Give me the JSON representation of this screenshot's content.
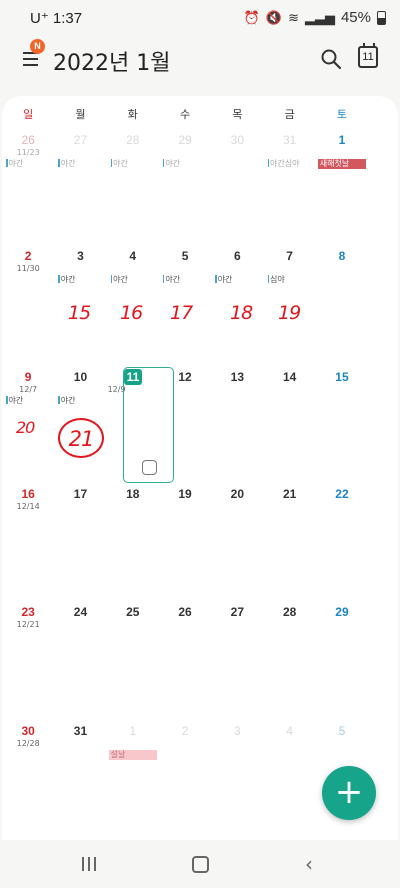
{
  "status_bar": {
    "carrier": "U⁺",
    "time": "1:37",
    "battery": "45%"
  },
  "header": {
    "badge": "N",
    "title": "2022년 1월",
    "today_label": "11"
  },
  "weekdays": [
    "일",
    "월",
    "화",
    "수",
    "목",
    "금",
    "토"
  ],
  "weeks": [
    [
      {
        "day": "26",
        "lunar": "11/23",
        "events": [
          "야간"
        ],
        "dim": true
      },
      {
        "day": "27",
        "events": [
          "야간"
        ],
        "dim": true
      },
      {
        "day": "28",
        "events": [
          "야간"
        ],
        "dim": true
      },
      {
        "day": "29",
        "events": [
          "야간"
        ],
        "dim": true
      },
      {
        "day": "30",
        "events": [],
        "dim": true
      },
      {
        "day": "31",
        "events": [
          "야간심야"
        ],
        "dim": true
      },
      {
        "day": "1",
        "events": [],
        "holiday": "새해첫날"
      }
    ],
    [
      {
        "day": "2",
        "lunar": "11/30",
        "events": []
      },
      {
        "day": "3",
        "events": [
          "야간"
        ]
      },
      {
        "day": "4",
        "events": [
          "야간"
        ]
      },
      {
        "day": "5",
        "events": [
          "야간"
        ]
      },
      {
        "day": "6",
        "events": [
          "야간"
        ]
      },
      {
        "day": "7",
        "events": [
          "심야"
        ]
      },
      {
        "day": "8",
        "events": []
      }
    ],
    [
      {
        "day": "9",
        "lunar": "12/7",
        "events": [
          "야간"
        ]
      },
      {
        "day": "10",
        "events": [
          "야간"
        ]
      },
      {
        "day": "11",
        "lunar": "12/9",
        "events": [],
        "today": true
      },
      {
        "day": "12",
        "events": []
      },
      {
        "day": "13",
        "events": []
      },
      {
        "day": "14",
        "events": []
      },
      {
        "day": "15",
        "events": []
      }
    ],
    [
      {
        "day": "16",
        "lunar": "12/14",
        "events": []
      },
      {
        "day": "17",
        "events": []
      },
      {
        "day": "18",
        "events": []
      },
      {
        "day": "19",
        "events": []
      },
      {
        "day": "20",
        "events": []
      },
      {
        "day": "21",
        "events": []
      },
      {
        "day": "22",
        "events": []
      }
    ],
    [
      {
        "day": "23",
        "lunar": "12/21",
        "events": []
      },
      {
        "day": "24",
        "events": []
      },
      {
        "day": "25",
        "events": []
      },
      {
        "day": "26",
        "events": []
      },
      {
        "day": "27",
        "events": []
      },
      {
        "day": "28",
        "events": []
      },
      {
        "day": "29",
        "events": []
      }
    ],
    [
      {
        "day": "30",
        "lunar": "12/28",
        "events": []
      },
      {
        "day": "31",
        "events": []
      },
      {
        "day": "1",
        "events": [],
        "dim": true,
        "holiday_pink": "설날"
      },
      {
        "day": "2",
        "events": [],
        "dim": true
      },
      {
        "day": "3",
        "events": [],
        "dim": true
      },
      {
        "day": "4",
        "events": [],
        "dim": true
      },
      {
        "day": "5",
        "events": [],
        "dim": true
      }
    ]
  ],
  "handwriting": {
    "n15": "15",
    "n16": "16",
    "n17": "17",
    "n18": "18",
    "n19": "19",
    "n20": "20",
    "n21": "21"
  },
  "colors": {
    "accent": "#17a38a",
    "sunday": "#d5252a",
    "saturday": "#1a86c7",
    "handwriting": "#e4151c"
  },
  "icons": {
    "add": "+",
    "back": "‹"
  }
}
